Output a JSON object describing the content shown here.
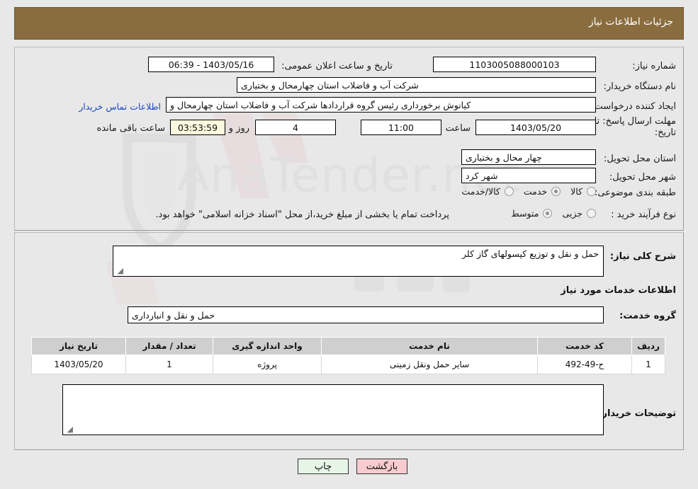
{
  "header": {
    "title": "جزئیات اطلاعات نیاز"
  },
  "form": {
    "need_number_label": "شماره نیاز:",
    "need_number_value": "1103005088000103",
    "announce_label": "تاریخ و ساعت اعلان عمومی:",
    "announce_value": "1403/05/16 - 06:39",
    "buyer_org_label": "نام دستگاه خریدار:",
    "buyer_org_value": "شرکت آب و فاضلاب استان چهارمحال و بختیاری",
    "creator_label": "ایجاد کننده درخواست:",
    "creator_value": "کیانوش برخورداری رئیس گروه قراردادها شرکت آب و فاضلاب استان چهارمحال و",
    "contact_link": "اطلاعات تماس خریدار",
    "deadline_label_line1": "مهلت ارسال پاسخ: تا",
    "deadline_label_line2": "تاریخ:",
    "deadline_date": "1403/05/20",
    "deadline_hour_label": "ساعت",
    "deadline_hour_value": "11:00",
    "remaining_days_value": "4",
    "remaining_days_label": "روز و",
    "remaining_time_value": "03:53:59",
    "remaining_time_label": "ساعت باقی مانده",
    "province_label": "استان محل تحویل:",
    "province_value": "چهار محال و بختیاری",
    "city_label": "شهر محل تحویل:",
    "city_value": "شهر کرد",
    "category_label": "طبقه بندی موضوعی:",
    "category_options": [
      {
        "label": "کالا",
        "selected": false
      },
      {
        "label": "خدمت",
        "selected": true
      },
      {
        "label": "کالا/خدمت",
        "selected": false
      }
    ],
    "process_label": "نوع فرآیند خرید :",
    "process_options": [
      {
        "label": "جزیی",
        "selected": false
      },
      {
        "label": "متوسط",
        "selected": true
      }
    ],
    "payment_note": "پرداخت تمام یا بخشی از مبلغ خرید،از محل \"اسناد خزانه اسلامی\" خواهد بود."
  },
  "description": {
    "need_summary_label": "شرح کلی نیاز:",
    "need_summary_value": "حمل و نقل و توزیع کپسولهای گاز کلر",
    "services_section_title": "اطلاعات خدمات مورد نیاز",
    "service_group_label": "گروه خدمت:",
    "service_group_value": "حمل و نقل و انبارداری"
  },
  "table": {
    "columns": [
      "ردیف",
      "کد خدمت",
      "نام خدمت",
      "واحد اندازه گیری",
      "تعداد / مقدار",
      "تاریخ نیاز"
    ],
    "rows": [
      {
        "radif": "1",
        "code": "ح-49-492",
        "name": "سایر حمل ونقل زمینی",
        "unit": "پروژه",
        "qty": "1",
        "date": "1403/05/20"
      }
    ]
  },
  "comments": {
    "label": "توضیحات خریدار:",
    "value": ""
  },
  "buttons": {
    "print": "چاپ",
    "back": "بازگشت"
  },
  "colors": {
    "header_bar": "#8a6d3f",
    "link": "#1b48c4",
    "print_btn": "#e7f5e7",
    "back_btn": "#f7ccd0",
    "timer_field": "#fbf8dd"
  },
  "watermark": {
    "text": "AnaTender.net"
  }
}
